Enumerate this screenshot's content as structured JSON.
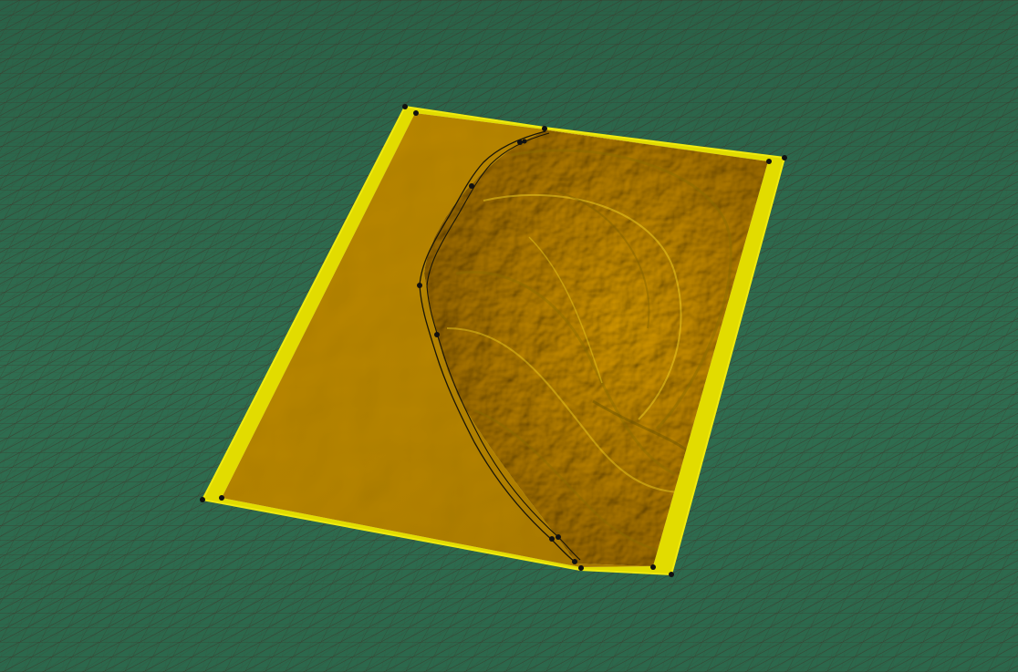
{
  "viewport": {
    "background_color": "#2f6b4f",
    "mesh_line_color": "#3a3a30",
    "terrain_patch_color": "#c9a300",
    "terrain_patch_border_color": "#e6e000",
    "edge_curve_color": "#1a1608",
    "vertex_handle_color": "#111111"
  }
}
